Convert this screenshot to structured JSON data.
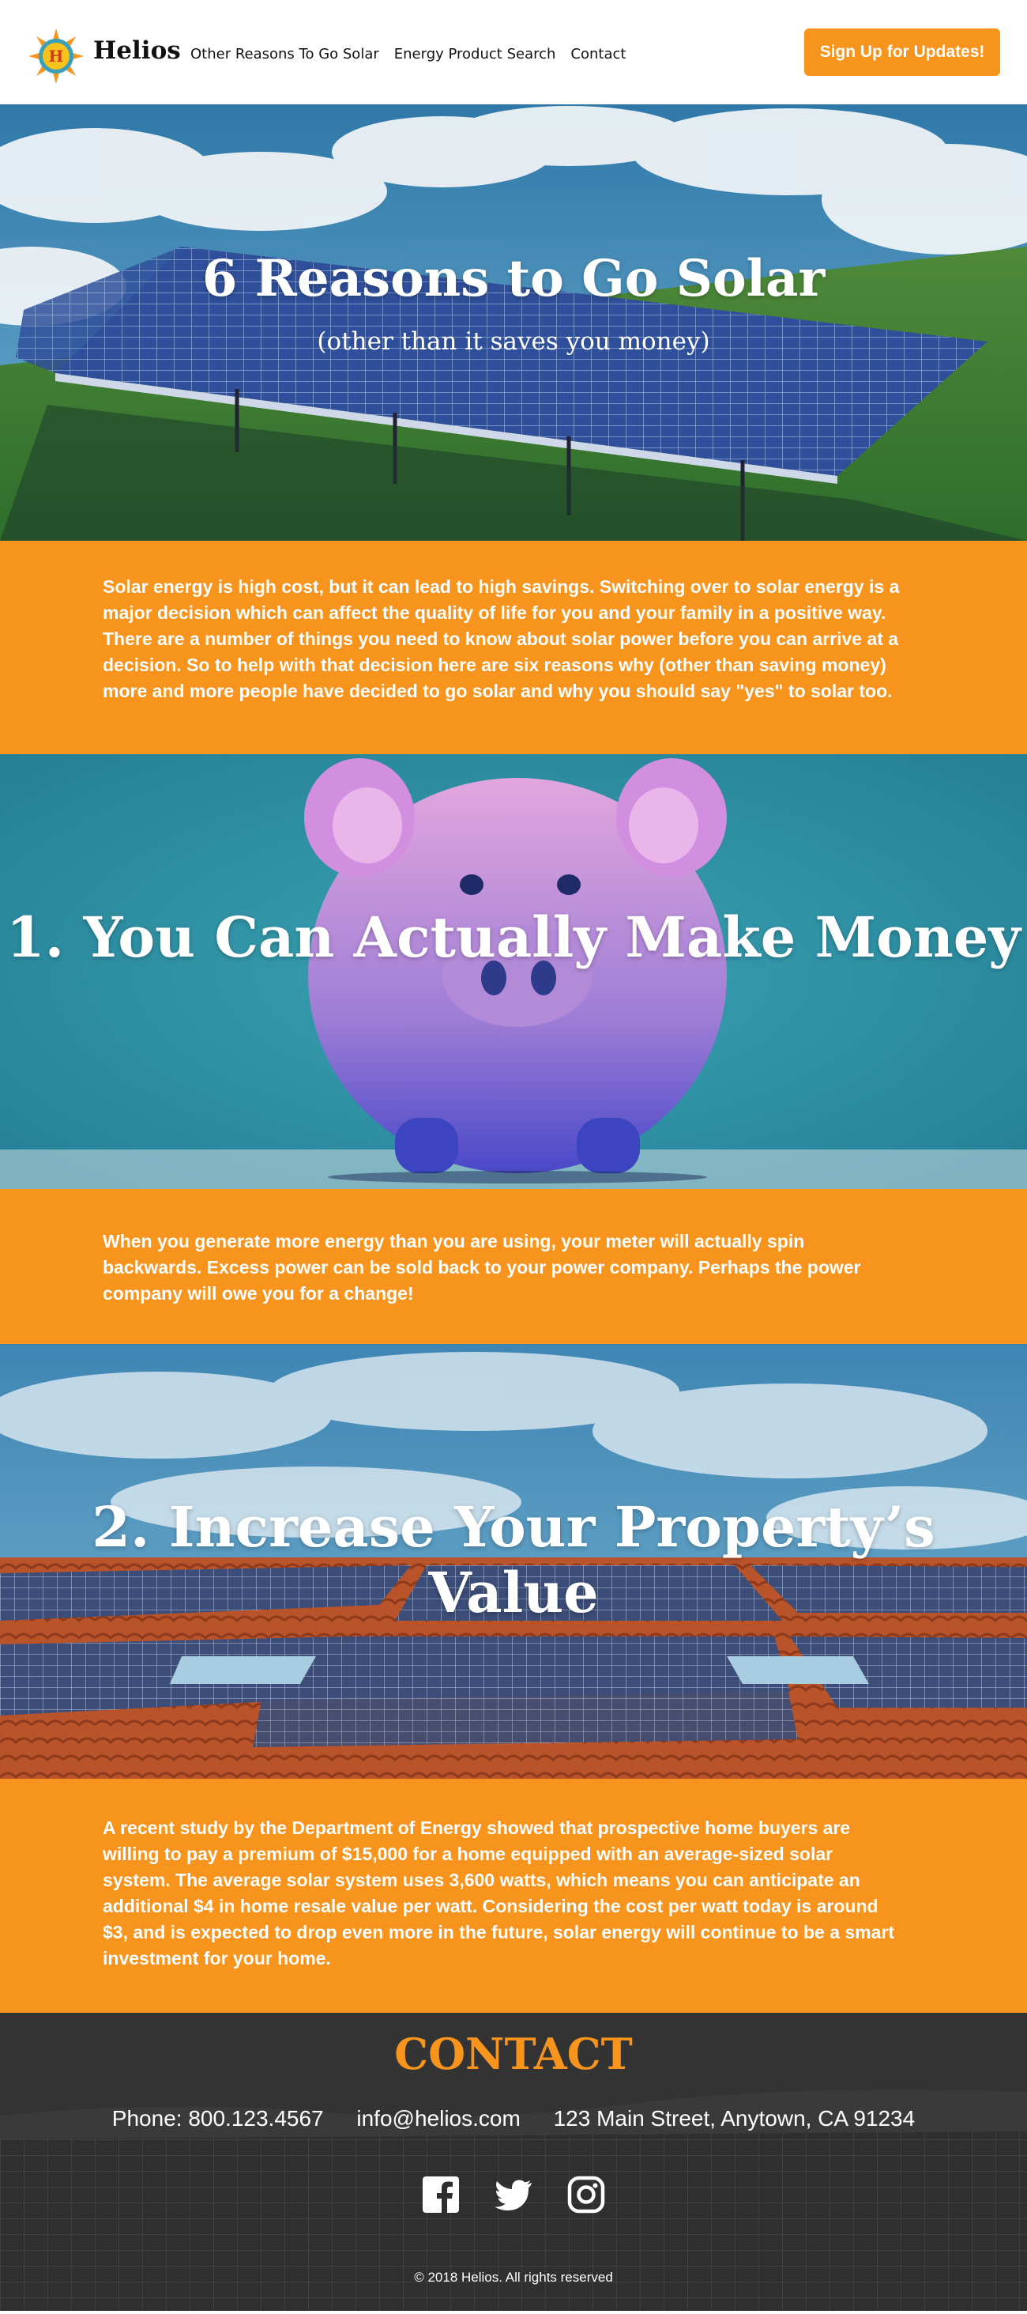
{
  "header": {
    "brand": "Helios",
    "logo_letter": "H",
    "nav": [
      "Other Reasons To Go Solar",
      "Energy Product Search",
      "Contact"
    ],
    "cta": "Sign Up for Updates!"
  },
  "hero": {
    "title": "6 Reasons to Go Solar",
    "subtitle": "(other than it saves you money)"
  },
  "intro": "Solar energy is high cost, but it can lead to high savings. Switching over to solar energy is a major decision which can affect the quality of life for you and your family in a positive way. There are a number of things you need to know about solar power before you can arrive at a decision. So to help with that decision here are six reasons why (other than saving money) more and more people have decided to go solar and why you should say \"yes\" to solar too.",
  "reasons": [
    {
      "title": "1. You Can Actually Make Money",
      "text": "When you generate more energy than you are using, your meter will actually spin backwards. Excess power can be sold back to your power company. Perhaps the power company will owe you for a change!"
    },
    {
      "title": "2. Increase Your Property’s Value",
      "text": "A recent study by the Department of Energy showed that prospective home buyers are willing to pay a premium of $15,000 for a home equipped with an average-sized solar system. The average solar system uses 3,600 watts, which means you can anticipate an additional $4 in home resale value per watt. Considering the cost per watt today is around $3, and is expected to drop even more in the future, solar energy will continue to be a smart investment for your home."
    }
  ],
  "footer": {
    "contact_title": "CONTACT",
    "phone": "Phone: 800.123.4567",
    "email": "info@helios.com",
    "address": "123 Main Street, Anytown, CA 91234",
    "social_icons": [
      "facebook-icon",
      "twitter-icon",
      "instagram-icon"
    ],
    "copyright": "© 2018 Helios. All rights reserved"
  },
  "colors": {
    "accent": "#f7941d",
    "footer_bg": "#2e2e2e"
  }
}
